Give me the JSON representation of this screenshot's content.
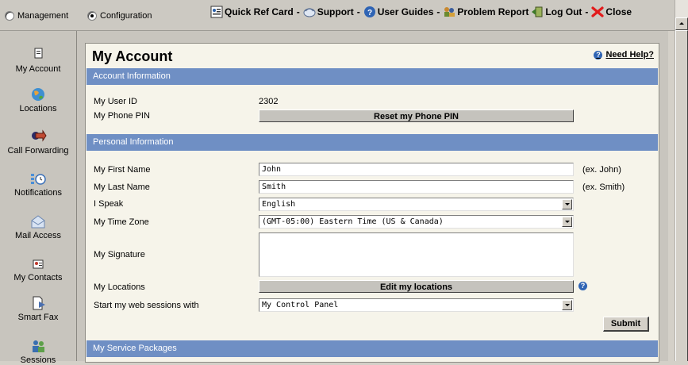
{
  "mode": {
    "management_label": "Management",
    "configuration_label": "Configuration",
    "selected": "Configuration"
  },
  "toolbar": {
    "quick_ref_label": "Quick Ref Card",
    "support_label": "Support",
    "user_guides_label": "User Guides",
    "problem_report_label": "Problem Report",
    "log_out_label": "Log Out",
    "close_label": "Close",
    "separator": "-"
  },
  "sidebar": {
    "items": [
      {
        "label": "My Account",
        "icon": "document-icon"
      },
      {
        "label": "Locations",
        "icon": "globe-icon"
      },
      {
        "label": "Call Forwarding",
        "icon": "forward-arrow-icon"
      },
      {
        "label": "Notifications",
        "icon": "clock-notification-icon"
      },
      {
        "label": "Mail Access",
        "icon": "mail-icon"
      },
      {
        "label": "My Contacts",
        "icon": "contact-card-icon"
      },
      {
        "label": "Smart Fax",
        "icon": "fax-icon"
      },
      {
        "label": "Sessions",
        "icon": "users-icon"
      }
    ]
  },
  "page": {
    "title": "My Account",
    "help_label": "Need Help?"
  },
  "account_info": {
    "section_title": "Account Information",
    "user_id_label": "My User ID",
    "user_id_value": "2302",
    "phone_pin_label": "My Phone PIN",
    "reset_pin_button": "Reset my Phone PIN"
  },
  "personal_info": {
    "section_title": "Personal Information",
    "first_name_label": "My First Name",
    "first_name_value": "John",
    "first_name_hint": "(ex. John)",
    "last_name_label": "My Last Name",
    "last_name_value": "Smith",
    "last_name_hint": "(ex. Smith)",
    "speak_label": "I Speak",
    "speak_value": "English",
    "time_zone_label": "My Time Zone",
    "time_zone_value": "(GMT-05:00) Eastern Time (US & Canada)",
    "signature_label": "My Signature",
    "signature_value": "",
    "locations_label": "My Locations",
    "edit_locations_button": "Edit my locations",
    "web_sessions_label": "Start my web sessions with",
    "web_sessions_value": "My Control Panel",
    "submit_label": "Submit"
  },
  "service_packages": {
    "section_title": "My Service Packages"
  },
  "colors": {
    "section_bar": "#6f8fc4",
    "card_background": "#f6f4ea",
    "chrome": "#ccc9c2",
    "close_x": "#e21b1b",
    "help_icon": "#2f64b4"
  }
}
